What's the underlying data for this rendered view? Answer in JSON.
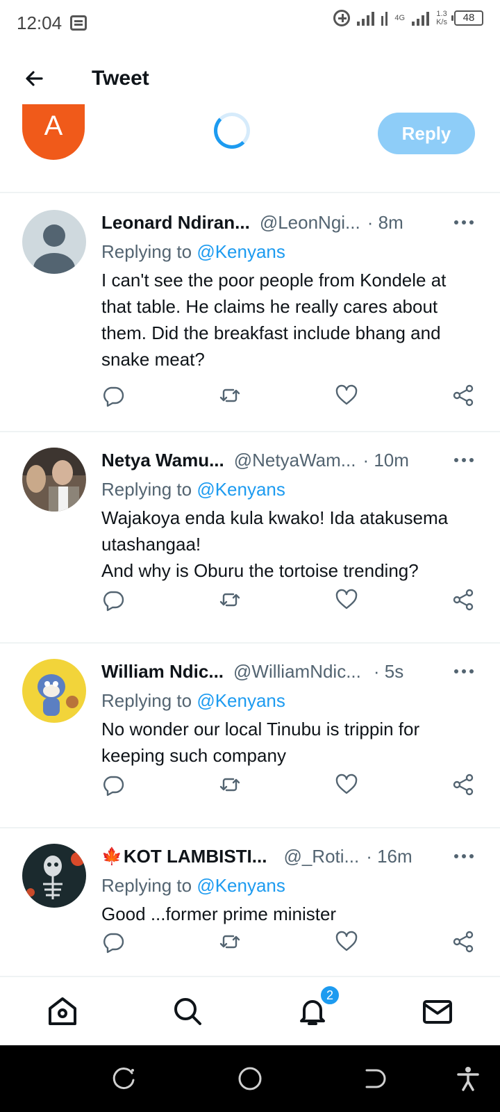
{
  "status_bar": {
    "time": "12:04",
    "network_type": "4G",
    "speed_value": "1.3",
    "speed_unit": "K/s",
    "battery": "48"
  },
  "header": {
    "title": "Tweet"
  },
  "compose": {
    "avatar_letter": "A",
    "reply_label": "Reply",
    "avatar_color": "#f05a1a",
    "button_color": "#8ecdf8"
  },
  "tweets": [
    {
      "name": "Leonard Ndiran...",
      "handle": "@LeonNgi...",
      "time": "· 8m",
      "replying_prefix": "Replying to",
      "replying_to": "@Kenyans",
      "text": "I can't see the poor people from Kondele at that table. He claims he really cares about them. Did the breakfast include bhang and snake meat?",
      "avatar": "default-avatar-icon"
    },
    {
      "name": "Netya Wamu...",
      "handle": "@NetyaWam...",
      "time": "· 10m",
      "replying_prefix": "Replying to",
      "replying_to": "@Kenyans",
      "text_lines": [
        "Wajakoya enda kula kwako! Ida atakusema utashangaa!",
        "And why is Oburu the tortoise trending?"
      ],
      "avatar": "photo-avatar"
    },
    {
      "name": "William Ndic...",
      "handle": "@WilliamNdic...",
      "time": "· 5s",
      "replying_prefix": "Replying to",
      "replying_to": "@Kenyans",
      "text": "No wonder our local Tinubu is trippin for keeping such company",
      "avatar": "cartoon-avatar"
    },
    {
      "name_flag": "🍁",
      "name": "KOT LAMBISTI...",
      "handle": "@_Roti...",
      "time": "· 16m",
      "replying_prefix": "Replying to",
      "replying_to": "@Kenyans",
      "text": "Good ...former prime minister",
      "avatar": "skeleton-avatar"
    }
  ],
  "bottom_nav": {
    "items": [
      "home-icon",
      "search-icon",
      "notifications-icon",
      "messages-icon"
    ],
    "notification_count": "2"
  },
  "colors": {
    "accent": "#1d9bf0",
    "text_primary": "#0f1419",
    "text_secondary": "#536471",
    "divider": "#eff3f4"
  }
}
